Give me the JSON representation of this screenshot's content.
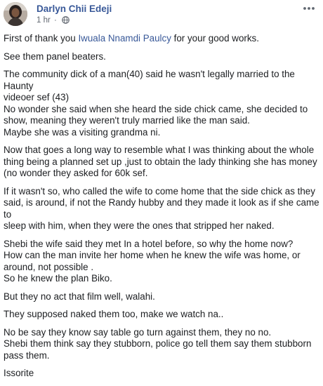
{
  "post": {
    "author": "Darlyn Chii Edeji",
    "time": "1 hr",
    "separator": "·",
    "avatar_icon": "profile-photo",
    "privacy_icon": "globe-icon",
    "more_icon": "more-options-icon",
    "paragraphs": [
      {
        "before": "First of thank you ",
        "mention": "Iwuala Nnamdi Paulcy",
        "after": " for your good works."
      },
      {
        "text": "See them panel beaters."
      },
      {
        "text": "The community dick of a man(40) said he wasn't legally married to the Haunty\nvideoer sef (43)\nNo wonder she said when she heard the side chick came, she decided to\nshow, meaning they weren't truly married like the man said.\nMaybe she was a visiting grandma ni."
      },
      {
        "text": "Now that goes a long way to resemble what I was thinking about the whole\nthing being a planned set up ,just to obtain the lady thinking she has money\n(no wonder they asked for 60k sef."
      },
      {
        "text": "If it wasn't so, who called the wife to come home that the side chick as they\nsaid, is around, if not the Randy hubby and they made it look as if she came to\nsleep with him, when they were the ones that stripped her naked."
      },
      {
        "text": "Shebi the wife said they met In a hotel before, so why the home now?\nHow can the man invite her home when he knew the wife was home, or\naround, not possible .\nSo he knew the plan Biko."
      },
      {
        "text": "But they no act that film well, walahi."
      },
      {
        "text": "They supposed naked them too, make we watch na.."
      },
      {
        "text": "No be say they know say table go turn against them, they no no.\nShebi them think say they stubborn, police go tell them say them stubborn\npass them."
      },
      {
        "text": "Issorite"
      }
    ]
  },
  "colors": {
    "author": "#385898",
    "mention": "#385898",
    "meta": "#616770",
    "text": "#1c1e21"
  }
}
